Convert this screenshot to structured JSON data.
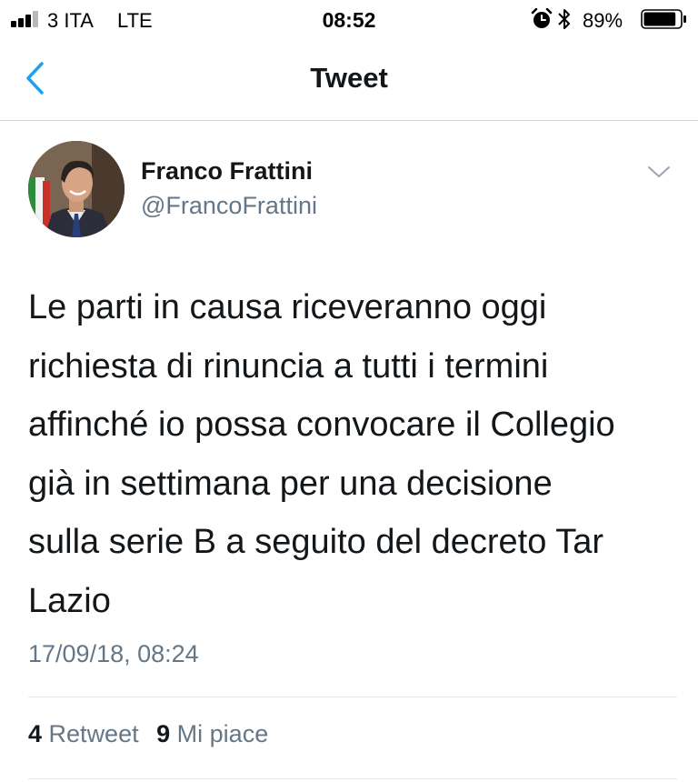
{
  "status_bar": {
    "carrier": "3 ITA",
    "network": "LTE",
    "time": "08:52",
    "battery_percent": "89%",
    "battery_level": 0.89,
    "icons": [
      "signal-bars-icon",
      "alarm-icon",
      "bluetooth-icon",
      "battery-icon"
    ]
  },
  "nav": {
    "title": "Tweet",
    "back_icon": "chevron-left-icon",
    "accent": "#1da1f2"
  },
  "tweet": {
    "author_name": "Franco Frattini",
    "author_handle": "@FrancoFrattini",
    "menu_icon": "chevron-down-icon",
    "lines": [
      "Le parti in causa riceveranno oggi",
      "richiesta di rinuncia a tutti i termini",
      "affinché io possa convocare il Collegio",
      "già in settimana per una decisione",
      "sulla serie B a seguito del decreto Tar",
      "Lazio"
    ],
    "timestamp": "17/09/18, 08:24",
    "retweet_count": "4",
    "retweet_label": "Retweet",
    "like_count": "9",
    "like_label": "Mi piace"
  },
  "colors": {
    "text": "#14171a",
    "secondary": "#657786",
    "divider": "#e1e8ed"
  }
}
